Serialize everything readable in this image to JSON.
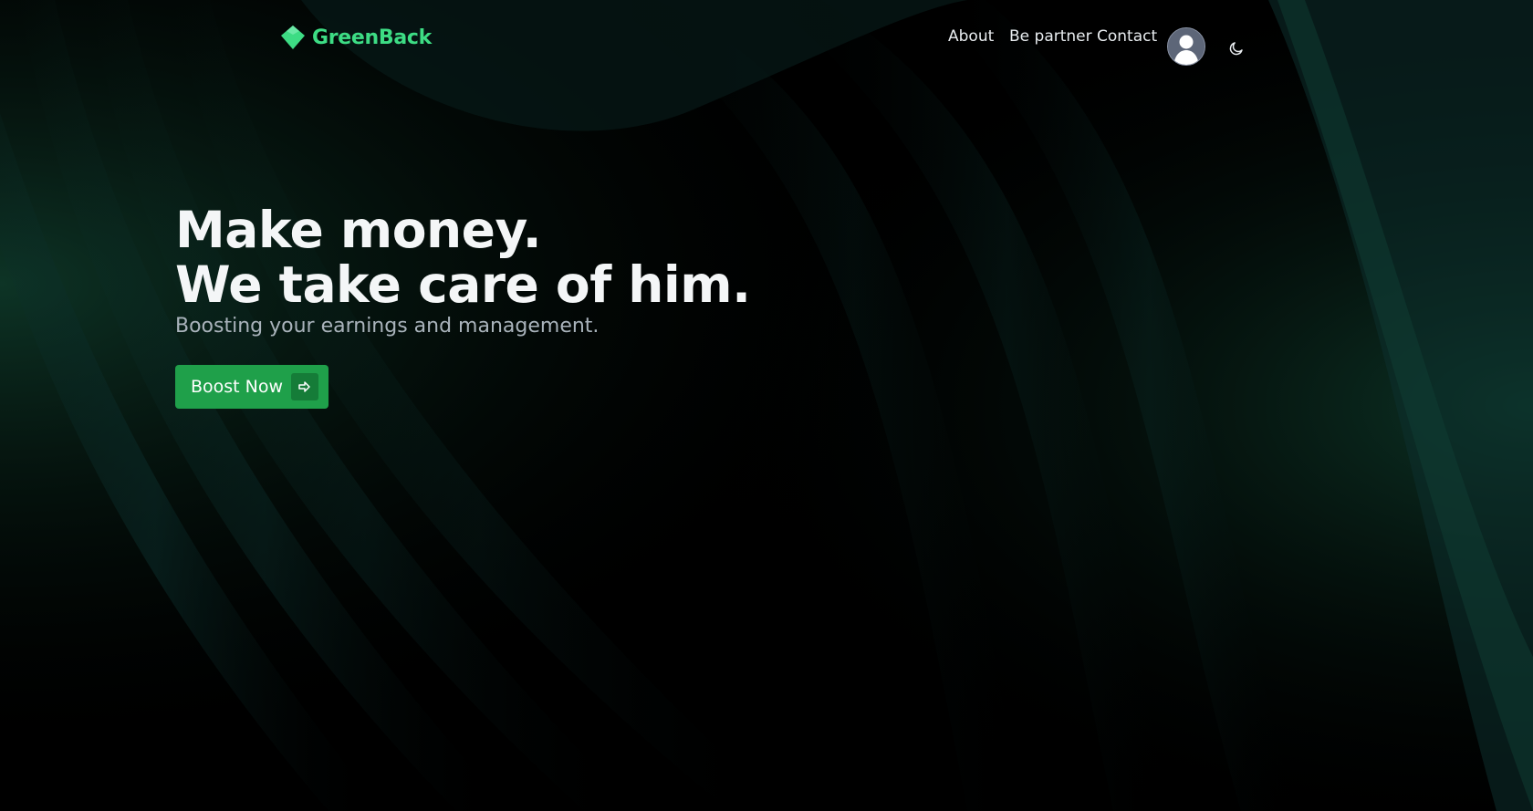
{
  "brand": {
    "name": "GreenBack",
    "logo_icon": "green-diamond-logo-icon",
    "color": "#3ddc84"
  },
  "nav": {
    "items": [
      {
        "label": "About"
      },
      {
        "label": "Be partner"
      },
      {
        "label": "Contact"
      }
    ],
    "avatar_icon": "user-avatar-icon",
    "theme_toggle_icon": "moon-icon"
  },
  "hero": {
    "title_line1": "Make money.",
    "title_line2": "We take care of him.",
    "subtitle": "Boosting your earnings and management.",
    "cta_label": "Boost Now",
    "cta_icon": "arrow-right-icon",
    "cta_color": "#1fa04a"
  },
  "theme": {
    "background": "#000000",
    "accent": "#3ddc84",
    "wave_tint": "#0d3b2e"
  }
}
